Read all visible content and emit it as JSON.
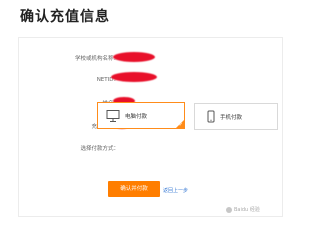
{
  "page": {
    "title": "确认充值信息"
  },
  "form": {
    "school_label": "学校或机构名称：",
    "netid_label": "NETID：",
    "name_label": "姓名：",
    "amount_label": "充值金额：",
    "amount_suffix": "元",
    "payment_label": "选择付款方式："
  },
  "payment": {
    "options": [
      {
        "label": "电脑付款",
        "icon": "monitor-icon",
        "selected": true
      },
      {
        "label": "手机付款",
        "icon": "phone-icon",
        "selected": false
      }
    ],
    "check_mark": "✓"
  },
  "actions": {
    "confirm_label": "确认并付款",
    "back_label": "返回上一步"
  },
  "watermark": {
    "text": "Baidu 经验"
  },
  "colors": {
    "accent": "#ff7e00",
    "link": "#3a7bd5",
    "redaction": "#e8102a"
  }
}
